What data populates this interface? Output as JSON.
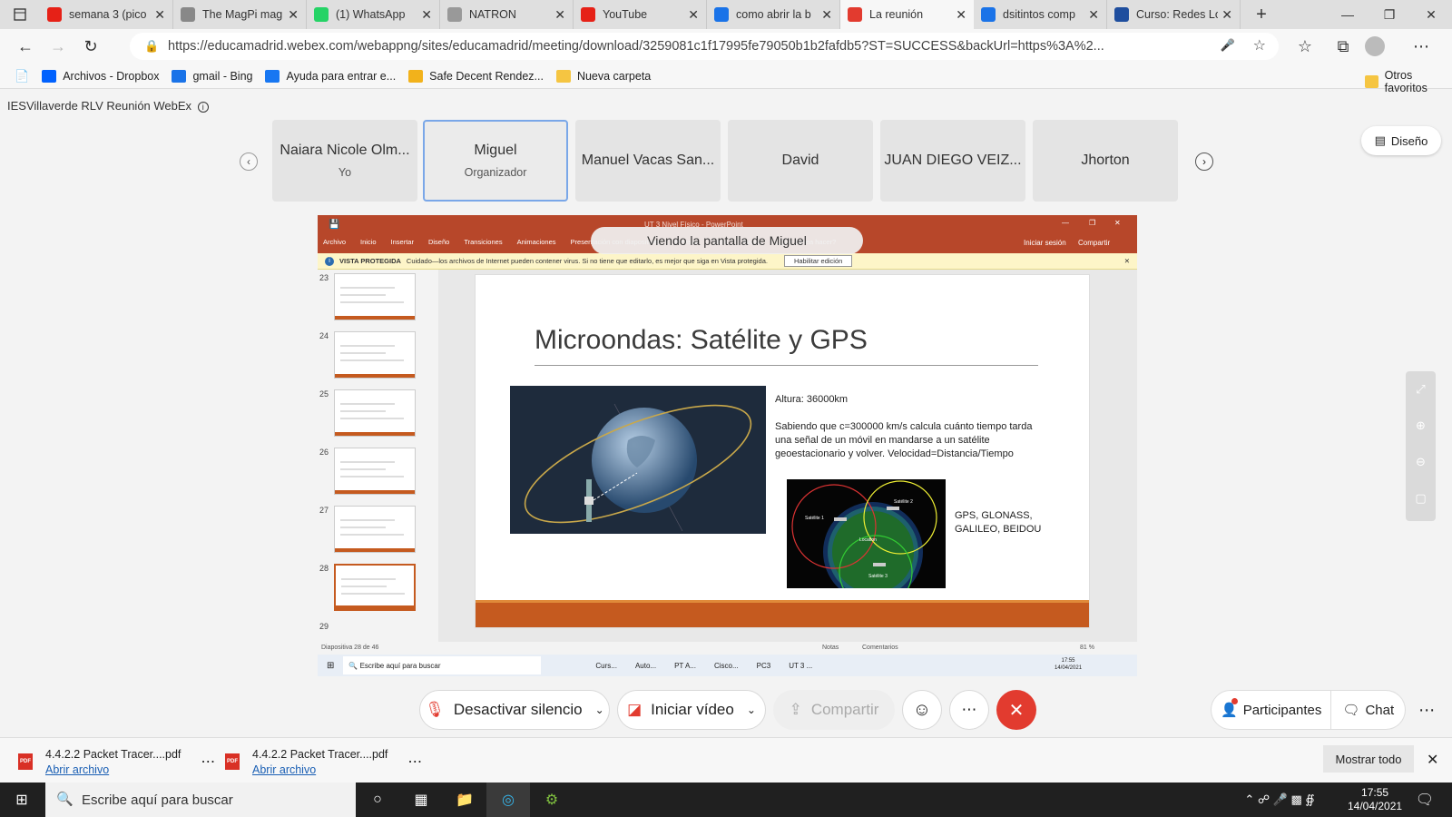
{
  "tabs": [
    {
      "label": "semana 3 (pico",
      "color": "#e62117",
      "icon": "youtube-icon"
    },
    {
      "label": "The MagPi mag",
      "color": "#888888",
      "icon": "magpi-icon"
    },
    {
      "label": "(1) WhatsApp",
      "color": "#25d366",
      "icon": "whatsapp-icon"
    },
    {
      "label": "NATRON",
      "color": "#999999",
      "icon": "natron-icon"
    },
    {
      "label": "YouTube",
      "color": "#e62117",
      "icon": "youtube-icon"
    },
    {
      "label": "como abrir la b",
      "color": "#1a73e8",
      "icon": "bing-icon"
    },
    {
      "label": "La reunión",
      "color": "#e23b2f",
      "icon": "webex-icon"
    },
    {
      "label": "dsitintos comp",
      "color": "#1a73e8",
      "icon": "bing-icon"
    },
    {
      "label": "Curso: Redes Lo",
      "color": "#1f4e9e",
      "icon": "moodle-icon"
    }
  ],
  "url": "https://educamadrid.webex.com/webappng/sites/educamadrid/meeting/download/3259081c1f17995fe79050b1b2fafdb5?ST=SUCCESS&backUrl=https%3A%2...",
  "bookmarks": [
    {
      "label": "Archivos - Dropbox",
      "color": "#0061fe"
    },
    {
      "label": "gmail - Bing",
      "color": "#1a73e8"
    },
    {
      "label": "Ayuda para entrar e...",
      "color": "#1877f2"
    },
    {
      "label": "Safe Decent Rendez...",
      "color": "#f2b21b"
    },
    {
      "label": "Nueva carpeta",
      "color": "#f5c542"
    }
  ],
  "bookmarks_other": "Otros favoritos",
  "meeting": {
    "title": "IESVillaverde RLV Reunión WebEx",
    "layout_button": "Diseño",
    "participants": [
      {
        "name": "Naiara Nicole Olm...",
        "role": "Yo"
      },
      {
        "name": "Miguel",
        "role": "Organizador"
      },
      {
        "name": "Manuel Vacas San...",
        "role": ""
      },
      {
        "name": "David",
        "role": ""
      },
      {
        "name": "JUAN DIEGO VEIZ...",
        "role": ""
      },
      {
        "name": "Jhorton",
        "role": ""
      }
    ],
    "viewing_banner": "Viendo la pantalla de Miguel"
  },
  "powerpoint": {
    "window_title": "UT 3 Nivel Físico - PowerPoint",
    "ribbon_tabs": [
      "Archivo",
      "Inicio",
      "Insertar",
      "Diseño",
      "Transiciones",
      "Animaciones",
      "Presentación con diapositivas",
      "Revisar",
      "Vista",
      "Ayuda",
      "¿Qué desea hacer?"
    ],
    "signin": "Iniciar sesión",
    "share": "Compartir",
    "protected_label": "VISTA PROTEGIDA",
    "protected_msg": "Cuidado—los archivos de Internet pueden contener virus. Si no tiene que editarlo, es mejor que siga en Vista protegida.",
    "enable_edit": "Habilitar edición",
    "thumbnails": [
      "23",
      "24",
      "25",
      "26",
      "27",
      "28",
      "29"
    ],
    "status": "Diapositiva 28 de 46",
    "notes": "Notas",
    "comments": "Comentarios",
    "zoom": "81 %",
    "taskbar_search": "Escribe aquí para buscar",
    "taskbar_apps": [
      "Curs...",
      "Auto...",
      "PT A...",
      "Cisco...",
      "PC3",
      "UT 3 ..."
    ],
    "taskbar_time": "17:55",
    "taskbar_date": "14/04/2021"
  },
  "slide": {
    "title": "Microondas: Satélite y GPS",
    "altura": "Altura: 36000km",
    "body": "Sabiendo que c=300000 km/s calcula cuánto tiempo tarda una señal de un móvil en mandarse a un satélite geoestacionario y volver. Velocidad=Distancia/Tiempo",
    "gnss": "GPS, GLONASS, GALILEO, BEIDOU",
    "sat1": "Satélite 1",
    "sat2": "Satélite 2",
    "sat3": "Satélite 3",
    "location": "Location"
  },
  "controls": {
    "mute": "Desactivar silencio",
    "video": "Iniciar vídeo",
    "share": "Compartir",
    "participants": "Participantes",
    "chat": "Chat"
  },
  "downloads": [
    {
      "name": "4.4.2.2 Packet Tracer....pdf",
      "link": "Abrir archivo"
    },
    {
      "name": "4.4.2.2 Packet Tracer....pdf",
      "link": "Abrir archivo"
    }
  ],
  "show_all": "Mostrar todo",
  "taskbar": {
    "search": "Escribe aquí para buscar",
    "time": "17:55",
    "date": "14/04/2021"
  },
  "colors": {
    "accent_pp": "#b7472a",
    "slide_bar": "#c55a1f",
    "end_call": "#e23b2f"
  }
}
